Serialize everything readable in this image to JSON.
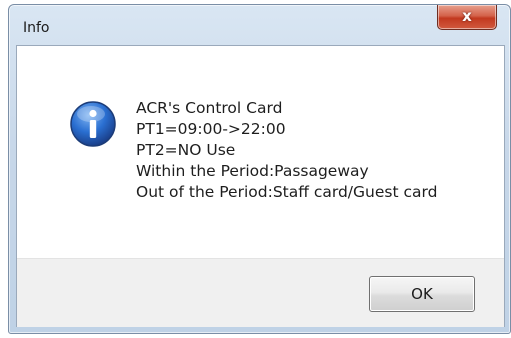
{
  "window": {
    "title": "Info",
    "close_label": "x"
  },
  "message": {
    "icon": "info-icon",
    "lines": [
      "ACR's Control Card",
      "PT1=09:00->22:00",
      "PT2=NO Use",
      "Within the Period:Passageway",
      "Out of the Period:Staff card/Guest card"
    ]
  },
  "buttons": {
    "ok_label": "OK"
  },
  "colors": {
    "close_button": "#c2391f",
    "info_icon": "#2a6fd1",
    "title_bar": "#c7d7e9"
  }
}
